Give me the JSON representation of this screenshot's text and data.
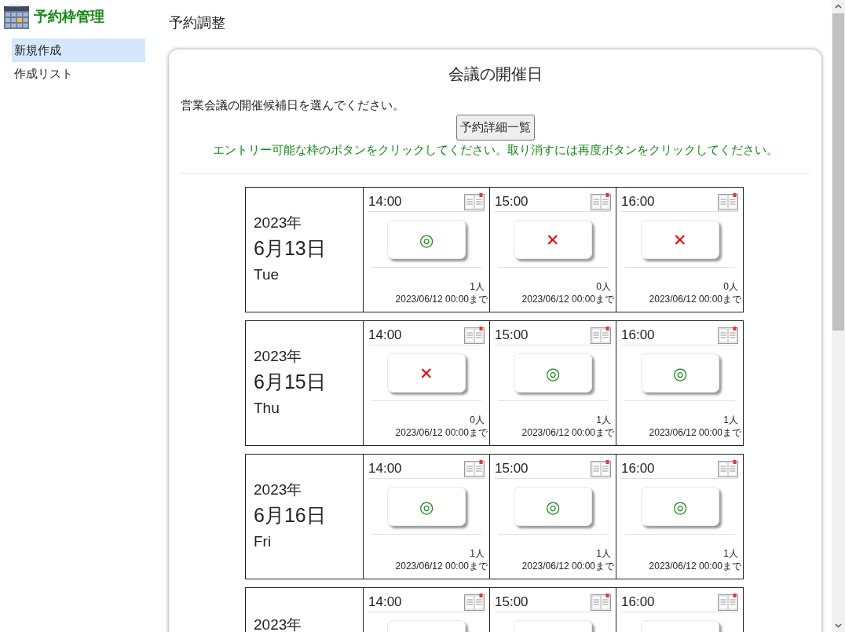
{
  "app": {
    "title": "予約枠管理"
  },
  "sidebar": {
    "items": [
      {
        "label": "新規作成",
        "selected": true
      },
      {
        "label": "作成リスト",
        "selected": false
      }
    ]
  },
  "page_title": "予約調整",
  "card": {
    "heading": "会議の開催日",
    "description": "営業会議の開催候補日を選んでください。",
    "detail_button": "予約詳細一覧",
    "instruction": "エントリー可能な枠のボタンをクリックしてください。取り消すには再度ボタンをクリックしてください。"
  },
  "days": [
    {
      "year": "2023年",
      "date": "6月13日",
      "weekday": "Tue",
      "slots": [
        {
          "time": "14:00",
          "kind": "available",
          "mark": "◎",
          "count": "1人",
          "deadline": "2023/06/12 00:00まで"
        },
        {
          "time": "15:00",
          "kind": "full",
          "mark": "✕",
          "count": "0人",
          "deadline": "2023/06/12 00:00まで"
        },
        {
          "time": "16:00",
          "kind": "full",
          "mark": "✕",
          "count": "0人",
          "deadline": "2023/06/12 00:00まで"
        }
      ]
    },
    {
      "year": "2023年",
      "date": "6月15日",
      "weekday": "Thu",
      "slots": [
        {
          "time": "14:00",
          "kind": "full",
          "mark": "✕",
          "count": "0人",
          "deadline": "2023/06/12 00:00まで"
        },
        {
          "time": "15:00",
          "kind": "available",
          "mark": "◎",
          "count": "1人",
          "deadline": "2023/06/12 00:00まで"
        },
        {
          "time": "16:00",
          "kind": "available",
          "mark": "◎",
          "count": "1人",
          "deadline": "2023/06/12 00:00まで"
        }
      ]
    },
    {
      "year": "2023年",
      "date": "6月16日",
      "weekday": "Fri",
      "slots": [
        {
          "time": "14:00",
          "kind": "available",
          "mark": "◎",
          "count": "1人",
          "deadline": "2023/06/12 00:00まで"
        },
        {
          "time": "15:00",
          "kind": "available",
          "mark": "◎",
          "count": "1人",
          "deadline": "2023/06/12 00:00まで"
        },
        {
          "time": "16:00",
          "kind": "available",
          "mark": "◎",
          "count": "1人",
          "deadline": "2023/06/12 00:00まで"
        }
      ]
    },
    {
      "year": "2023年",
      "slots": [
        {
          "time": "14:00"
        },
        {
          "time": "15:00"
        },
        {
          "time": "16:00"
        }
      ]
    }
  ]
}
